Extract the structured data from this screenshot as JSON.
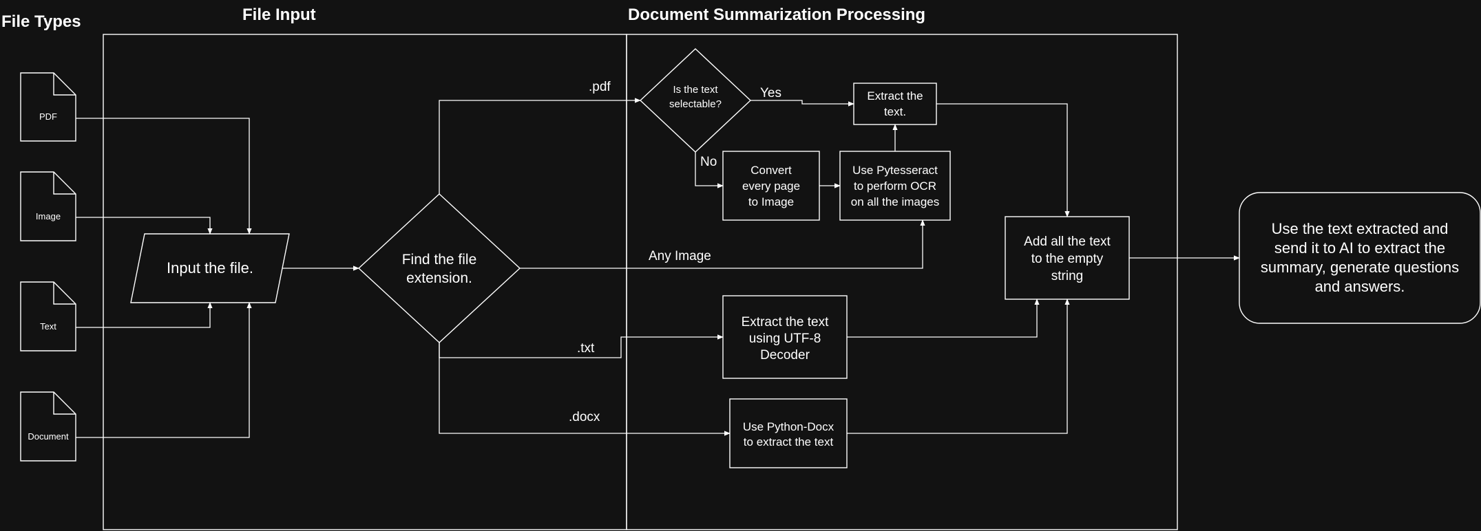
{
  "colors": {
    "background": "#121212",
    "stroke": "#ffffff",
    "text": "#ffffff"
  },
  "lanes": {
    "file_types": "File Types",
    "file_input": "File Input",
    "processing": "Document Summarization Processing"
  },
  "files": {
    "pdf": "PDF",
    "image": "Image",
    "text": "Text",
    "document": "Document"
  },
  "nodes": {
    "input_file": "Input the file.",
    "find_extension": [
      "Find the file",
      "extension."
    ],
    "is_selectable": [
      "Is the text",
      "selectable?"
    ],
    "extract_text": [
      "Extract the",
      "text."
    ],
    "convert_pages": [
      "Convert",
      "every page",
      "to Image"
    ],
    "pytesseract": [
      "Use Pytesseract",
      "to perform OCR",
      "on all the images"
    ],
    "utf8": [
      "Extract the text",
      "using UTF-8",
      "Decoder"
    ],
    "python_docx": [
      "Use Python-Docx",
      "to extract the text"
    ],
    "add_text": [
      "Add all the text",
      "to the empty",
      "string"
    ],
    "ai_summary": [
      "Use the text extracted and",
      "send it to AI to extract the",
      "summary, generate questions",
      "and answers."
    ]
  },
  "edge_labels": {
    "pdf": ".pdf",
    "yes": "Yes",
    "no": "No",
    "any_image": "Any Image",
    "txt": ".txt",
    "docx": ".docx"
  }
}
